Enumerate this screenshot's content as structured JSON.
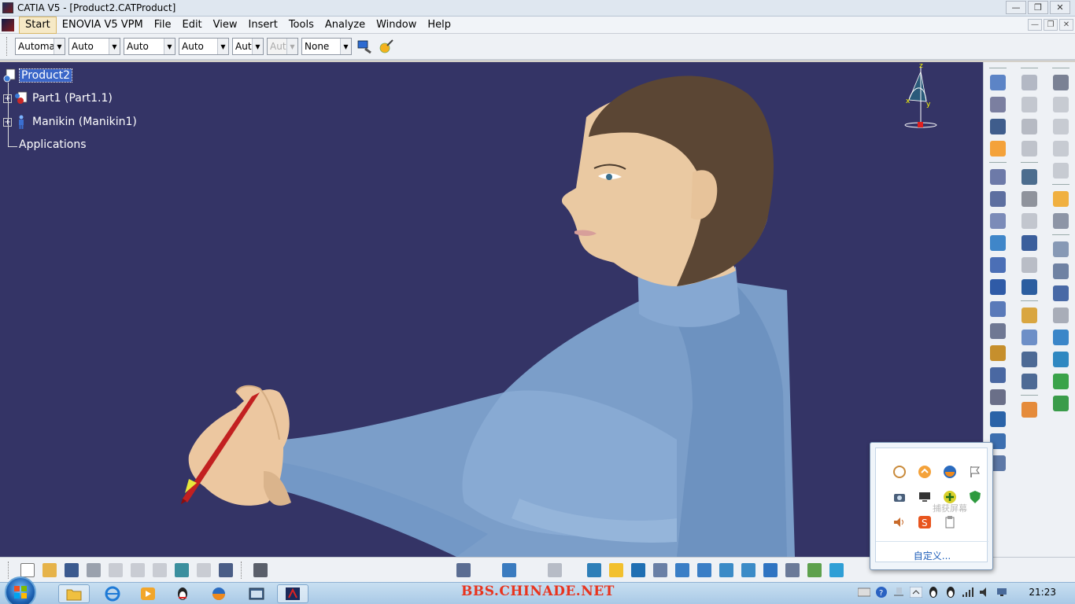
{
  "window": {
    "title": "CATIA V5 - [Product2.CATProduct]"
  },
  "menubar": {
    "items": [
      "Start",
      "ENOVIA V5 VPM",
      "File",
      "Edit",
      "View",
      "Insert",
      "Tools",
      "Analyze",
      "Window",
      "Help"
    ],
    "active": "Start"
  },
  "graphic_properties": {
    "fill_color": "Automa",
    "transparency": "Auto",
    "line_thickness": "Auto",
    "line_type": "Auto",
    "point_symbol": "Aut",
    "rendering_style": "Aut",
    "layer": "None"
  },
  "tree": {
    "root": "Product2",
    "children": [
      "Part1 (Part1.1)",
      "Manikin (Manikin1)"
    ],
    "applications": "Applications"
  },
  "tray_popup": {
    "tooltip": "捕获屏幕",
    "customize": "自定义..."
  },
  "taskbar": {
    "watermark": "BBS.CHINADE.NET",
    "clock": "21:23"
  },
  "colors": {
    "viewport_bg": "#343466",
    "selection": "#3a66c8"
  }
}
